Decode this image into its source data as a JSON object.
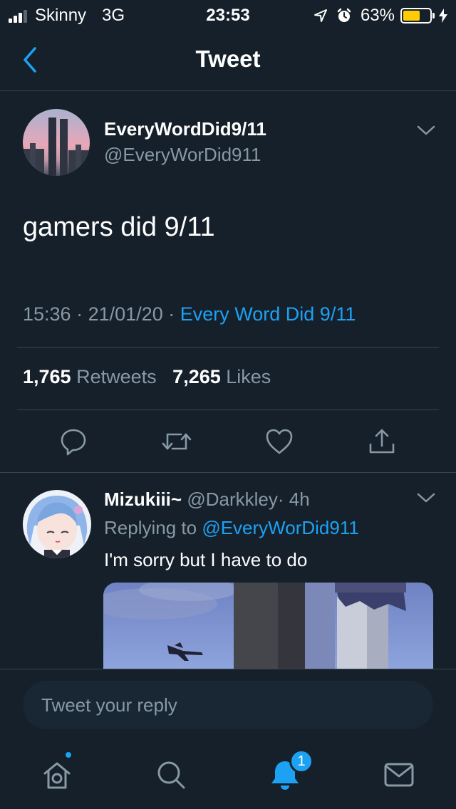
{
  "status_bar": {
    "carrier": "Skinny",
    "network": "3G",
    "time": "23:53",
    "battery_percent": "63%",
    "battery_level": 0.63,
    "icons": [
      "signal-icon",
      "location-arrow-icon",
      "alarm-icon",
      "battery-icon",
      "charging-bolt-icon"
    ]
  },
  "nav": {
    "title": "Tweet",
    "back_icon": "chevron-left-icon"
  },
  "tweet": {
    "author_name": "EveryWordDid9/11",
    "author_handle": "@EveryWorDid911",
    "text": "gamers did 9/11",
    "time": "15:36",
    "separator": "·",
    "date": "21/01/20",
    "source": "Every Word Did 9/11",
    "retweets_count": "1,765",
    "retweets_label": "Retweets",
    "likes_count": "7,265",
    "likes_label": "Likes",
    "actions": [
      "reply-icon",
      "retweet-icon",
      "like-icon",
      "share-icon"
    ]
  },
  "reply": {
    "author_name": "Mizukiii~",
    "author_handle": "@Darkkley",
    "separator": "·",
    "age": "4h",
    "replying_label": "Replying to",
    "replying_to": "@EveryWorDid911",
    "text": "I'm sorry but I have to do"
  },
  "compose": {
    "placeholder": "Tweet your reply"
  },
  "tab_bar": {
    "items": [
      "home-icon",
      "search-icon",
      "notifications-icon",
      "messages-icon"
    ],
    "notifications_badge": "1"
  },
  "colors": {
    "background": "#15202b",
    "accent": "#1da1f2",
    "secondary_text": "#8899a6",
    "divider": "#38444d",
    "battery": "#ffcc00"
  }
}
